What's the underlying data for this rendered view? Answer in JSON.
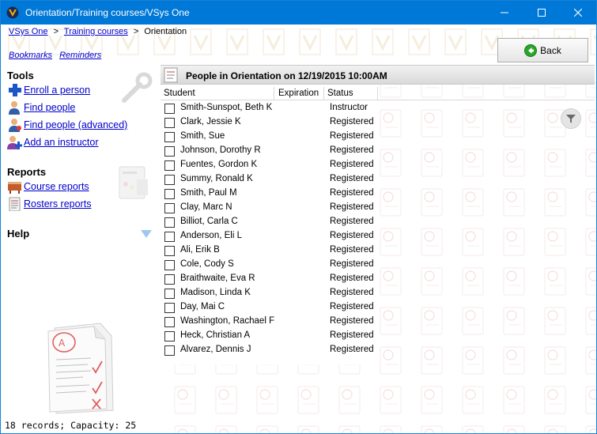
{
  "window": {
    "title": "Orientation/Training courses/VSys One"
  },
  "breadcrumb": {
    "items": [
      {
        "label": "VSys One"
      },
      {
        "label": "Training courses"
      },
      {
        "label": "Orientation"
      }
    ],
    "separator": ">"
  },
  "quicklinks": {
    "bookmarks": "Bookmarks",
    "reminders": "Reminders"
  },
  "back_button": {
    "label": "Back"
  },
  "tools": {
    "title": "Tools",
    "items": [
      {
        "label": "Enroll a person",
        "icon": "enroll-plus-icon"
      },
      {
        "label": "Find people",
        "icon": "person-icon"
      },
      {
        "label": "Find people (advanced)",
        "icon": "person-advanced-icon"
      },
      {
        "label": "Add an instructor",
        "icon": "add-instructor-icon"
      }
    ]
  },
  "reports": {
    "title": "Reports",
    "items": [
      {
        "label": "Course reports",
        "icon": "course-report-icon"
      },
      {
        "label": "Rosters reports",
        "icon": "roster-report-icon"
      }
    ]
  },
  "help": {
    "title": "Help"
  },
  "list": {
    "header_title": "People in Orientation on 12/19/2015 10:00AM",
    "columns": {
      "student": "Student",
      "expiration": "Expiration",
      "status": "Status"
    },
    "rows": [
      {
        "name": "Smith-Sunspot, Beth K",
        "status": "Instructor"
      },
      {
        "name": "Clark, Jessie K",
        "status": "Registered"
      },
      {
        "name": "Smith, Sue",
        "status": "Registered"
      },
      {
        "name": "Johnson, Dorothy R",
        "status": "Registered"
      },
      {
        "name": "Fuentes, Gordon K",
        "status": "Registered"
      },
      {
        "name": "Summy, Ronald K",
        "status": "Registered"
      },
      {
        "name": "Smith, Paul M",
        "status": "Registered"
      },
      {
        "name": "Clay, Marc N",
        "status": "Registered"
      },
      {
        "name": "Billiot, Carla C",
        "status": "Registered"
      },
      {
        "name": "Anderson, Eli L",
        "status": "Registered"
      },
      {
        "name": "Ali, Erik B",
        "status": "Registered"
      },
      {
        "name": "Cole, Cody S",
        "status": "Registered"
      },
      {
        "name": "Braithwaite, Eva R",
        "status": "Registered"
      },
      {
        "name": "Madison, Linda K",
        "status": "Registered"
      },
      {
        "name": "Day, Mai C",
        "status": "Registered"
      },
      {
        "name": "Washington, Rachael F",
        "status": "Registered"
      },
      {
        "name": "Heck, Christian A",
        "status": "Registered"
      },
      {
        "name": "Alvarez, Dennis J",
        "status": "Registered"
      }
    ]
  },
  "status_bar": {
    "text": "18 records; Capacity: 25"
  },
  "colors": {
    "titlebar": "#0078d7",
    "link": "#0000cc",
    "back_arrow": "#2aa52a"
  }
}
